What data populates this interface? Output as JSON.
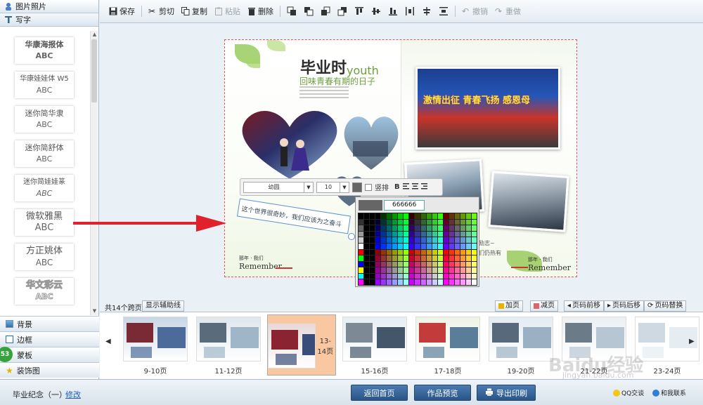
{
  "left_panel": {
    "photos_tab": "图片照片",
    "write_tab": "写字",
    "fonts": [
      {
        "name": "华康海报体",
        "sample": "ABC"
      },
      {
        "name": "华康娃娃体 W5",
        "sample": "ABC"
      },
      {
        "name": "迷你简华隶",
        "sample": "ABC"
      },
      {
        "name": "迷你简舒体",
        "sample": "ABC"
      },
      {
        "name": "迷你简娃娃篆",
        "sample": "ABC"
      },
      {
        "name": "微软雅黑",
        "sample": "ABC"
      },
      {
        "name": "方正姚体",
        "sample": "ABC"
      },
      {
        "name": "华文彩云",
        "sample": "ABC"
      }
    ],
    "categories": [
      "背景",
      "边框",
      "蒙板",
      "装饰图"
    ],
    "badge": "53"
  },
  "toolbar": {
    "save": "保存",
    "cut": "剪切",
    "copy": "复制",
    "paste": "粘贴",
    "delete": "删除",
    "undo": "撤销",
    "redo": "重做"
  },
  "canvas": {
    "title_cn": "毕业时",
    "title_en": "youth",
    "title_sub": "回味青春有期的日子",
    "banner": "激情出征  青春飞扬  感恩母",
    "textbox_text": "这个世界很奇妙，我们应该为之奋斗",
    "remember_small": "那年 · 我们",
    "remember": "Remember",
    "right_snippet_1": "励志~",
    "right_snippet_2": "们仍热有"
  },
  "text_format": {
    "font_name": "幼圆",
    "font_size": "10",
    "vertical_label": "竖排",
    "bold_label": "B"
  },
  "color_picker": {
    "hex_value": "666666",
    "current_color": "#666666"
  },
  "page_bar": {
    "total": "共14个跨页",
    "show_guides": "显示辅助线",
    "add_page": "加页",
    "remove_page": "减页",
    "page_forward": "页码前移",
    "page_back": "页码后移",
    "page_swap": "页码替换"
  },
  "thumbnails": [
    {
      "label": "9-10页",
      "selected": false
    },
    {
      "label": "11-12页",
      "selected": false
    },
    {
      "label": "13-14页",
      "selected": true
    },
    {
      "label": "15-16页",
      "selected": false
    },
    {
      "label": "17-18页",
      "selected": false
    },
    {
      "label": "19-20页",
      "selected": false
    },
    {
      "label": "21-22页",
      "selected": false
    },
    {
      "label": "23-24页",
      "selected": false
    }
  ],
  "bottom_bar": {
    "book_name": "毕业纪念（一）",
    "edit": "修改",
    "back_home": "返回首页",
    "preview": "作品预览",
    "export": "导出印刷",
    "qq": "QQ交谈",
    "contact": "和我联系"
  },
  "watermark": {
    "main": "Baidu经验",
    "sub": "jingyan.baidu.com"
  },
  "colors": {
    "accent": "#2a5486",
    "selected_thumb": "#f9c8a0",
    "arrow": "#e0202a",
    "guide_border": "#dd5555"
  }
}
